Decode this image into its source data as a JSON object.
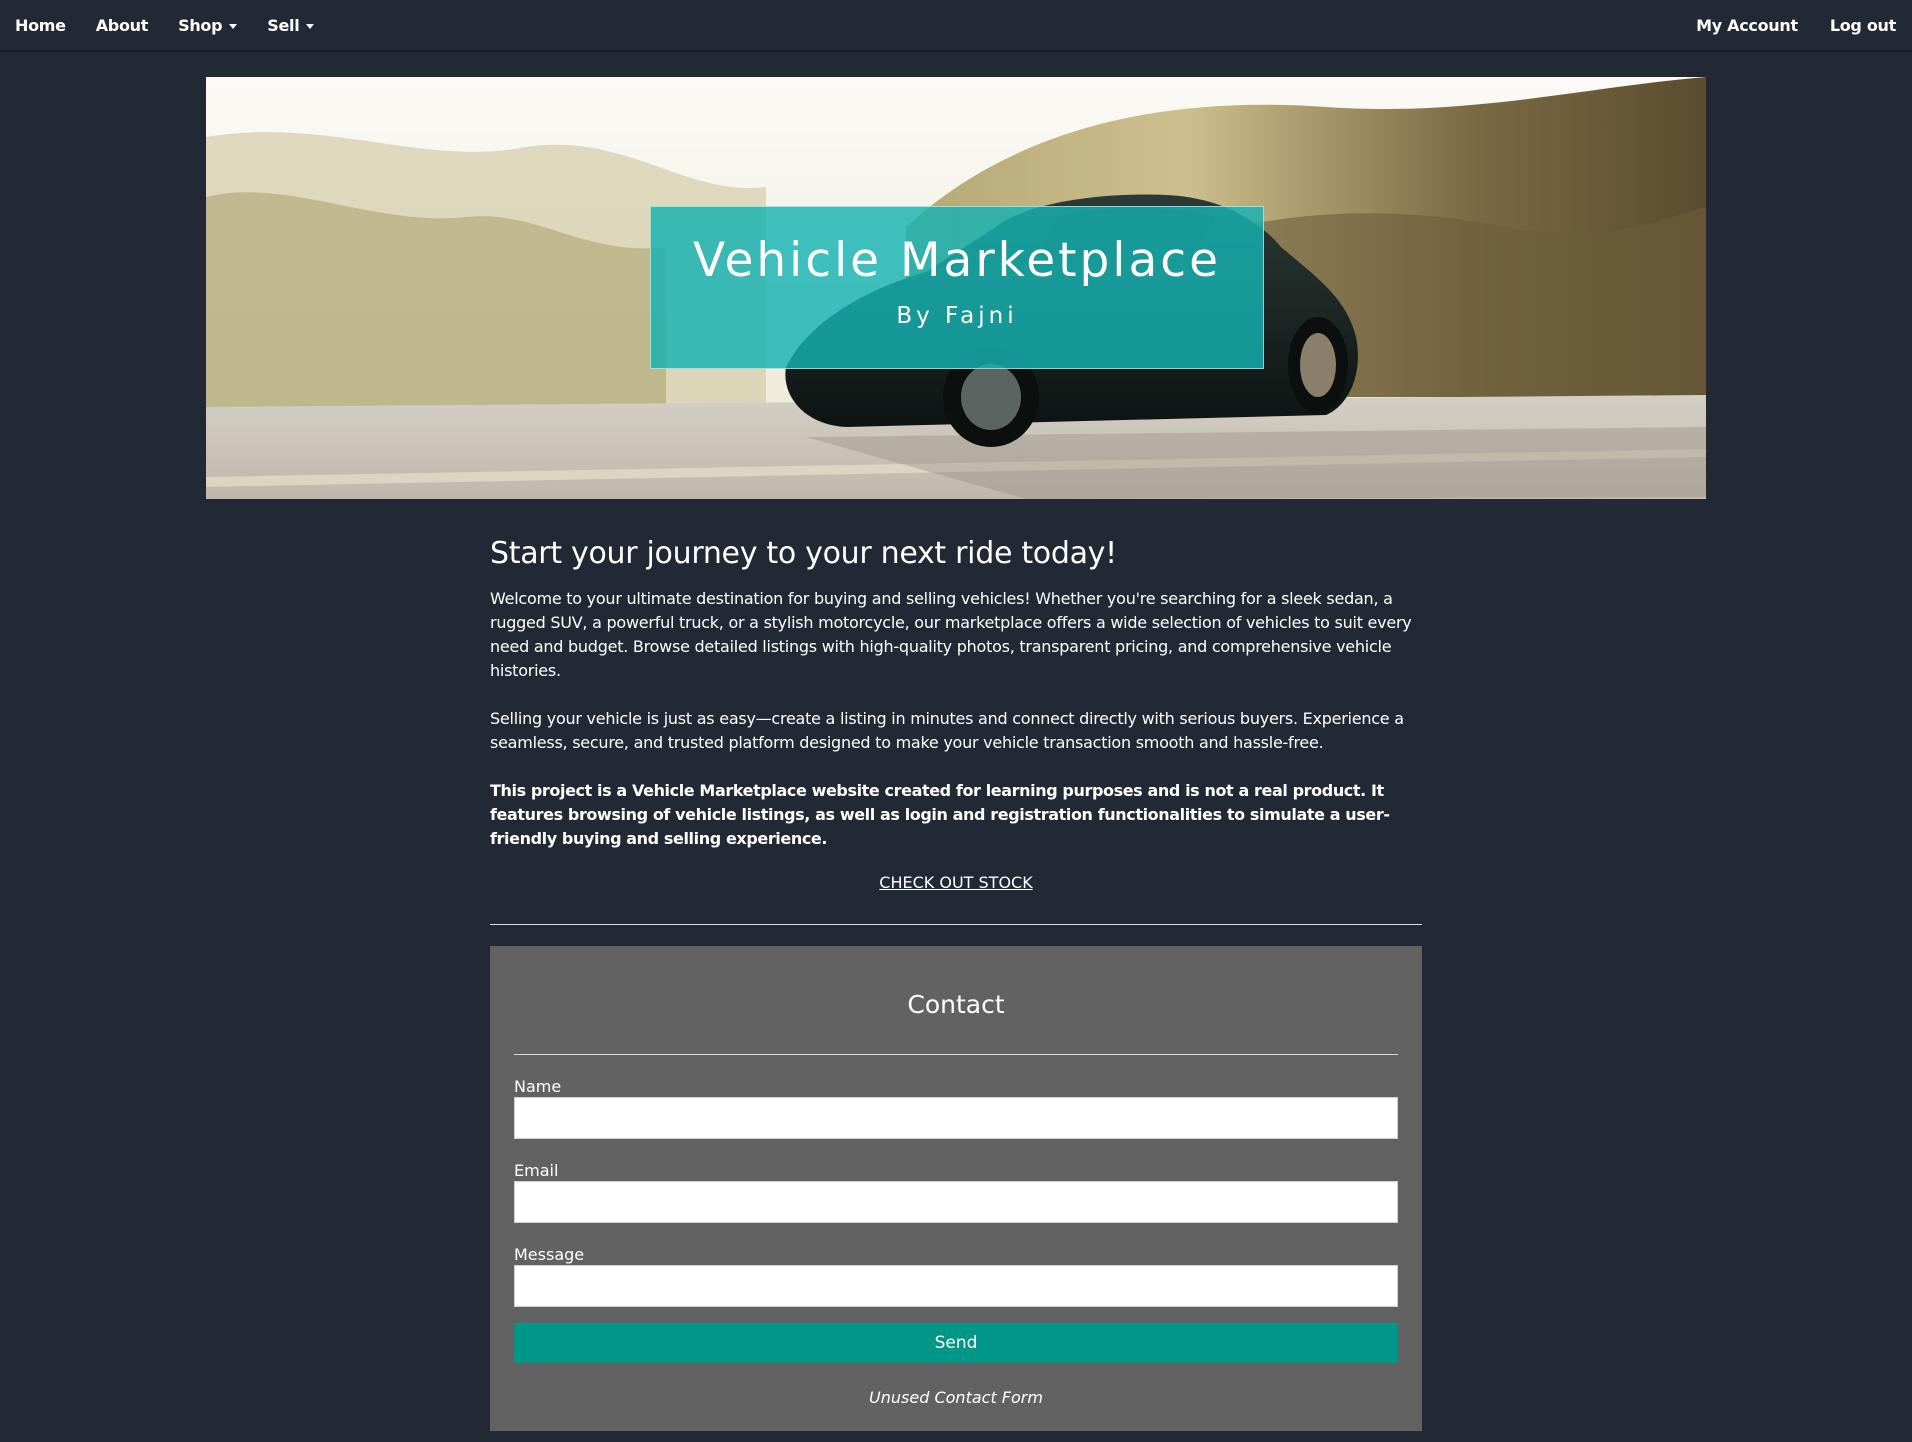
{
  "nav": {
    "left": [
      {
        "label": "Home",
        "dropdown": false
      },
      {
        "label": "About",
        "dropdown": false
      },
      {
        "label": "Shop",
        "dropdown": true
      },
      {
        "label": "Sell",
        "dropdown": true
      }
    ],
    "right": [
      {
        "label": "My Account"
      },
      {
        "label": "Log out"
      }
    ]
  },
  "hero": {
    "title": "Vehicle Marketplace",
    "subtitle": "By Fajni",
    "overlay_color": "#16b2b2"
  },
  "intro": {
    "heading": "Start your journey to your next ride today!",
    "paragraph1": "Welcome to your ultimate destination for buying and selling vehicles! Whether you're searching for a sleek sedan, a rugged SUV, a powerful truck, or a stylish motorcycle, our marketplace offers a wide selection of vehicles to suit every need and budget. Browse detailed listings with high-quality photos, transparent pricing, and comprehensive vehicle histories.",
    "paragraph2": "Selling your vehicle is just as easy—create a listing in minutes and connect directly with serious buyers. Experience a seamless, secure, and trusted platform designed to make your vehicle transaction smooth and hassle-free.",
    "paragraph3": "This project is a Vehicle Marketplace website created for learning purposes and is not a real product. It features browsing of vehicle listings, as well as login and registration functionalities to simulate a user-friendly buying and selling experience.",
    "cta": "CHECK OUT STOCK"
  },
  "contact": {
    "title": "Contact",
    "name_label": "Name",
    "name_value": "",
    "email_label": "Email",
    "email_value": "",
    "message_label": "Message",
    "message_value": "",
    "send_label": "Send",
    "note": "Unused Contact Form"
  },
  "colors": {
    "page_bg": "#222834",
    "contact_bg": "#626262",
    "send_button": "#009688"
  }
}
